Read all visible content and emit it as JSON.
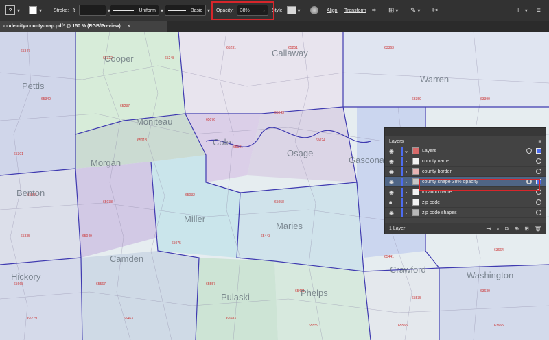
{
  "toolbar": {
    "question_label": "?",
    "stroke_label": "Stroke:",
    "stroke_weight_value": "",
    "profile_value": "Uniform",
    "brush_value": "Basic",
    "opacity_label": "Opacity:",
    "opacity_value": "38%",
    "style_label": "Style:",
    "align_label": "Align",
    "transform_label": "Transform"
  },
  "document_tab": {
    "title": "-code-city-county-map.pdf* @ 150 % (RGB/Preview)",
    "close_glyph": "×"
  },
  "map": {
    "county_labels": [
      "Cooper",
      "Callaway",
      "Pettis",
      "Moniteau",
      "Cole",
      "Osage",
      "Morgan",
      "Warren",
      "Gasconade",
      "Benton",
      "Miller",
      "Maries",
      "Camden",
      "Crawford",
      "Hickory",
      "Pulaski",
      "Phelps",
      "Washington"
    ]
  },
  "layers_panel": {
    "title": "Layers",
    "menu_glyph": "≡",
    "rows": [
      {
        "name": "Layers",
        "selected": false,
        "locked": false
      },
      {
        "name": "county name",
        "selected": false,
        "locked": false
      },
      {
        "name": "county border",
        "selected": false,
        "locked": false
      },
      {
        "name": "county shape 38% opacity",
        "selected": true,
        "locked": false
      },
      {
        "name": "location name",
        "selected": false,
        "locked": false
      },
      {
        "name": "zip code",
        "selected": false,
        "locked": true
      },
      {
        "name": "zip code shapes",
        "selected": false,
        "locked": false
      }
    ],
    "footer_count": "1 Layer"
  },
  "colors": {
    "highlight": "#d7262b",
    "layer_color": "#4d6cf0",
    "ui_dark": "#323232"
  }
}
